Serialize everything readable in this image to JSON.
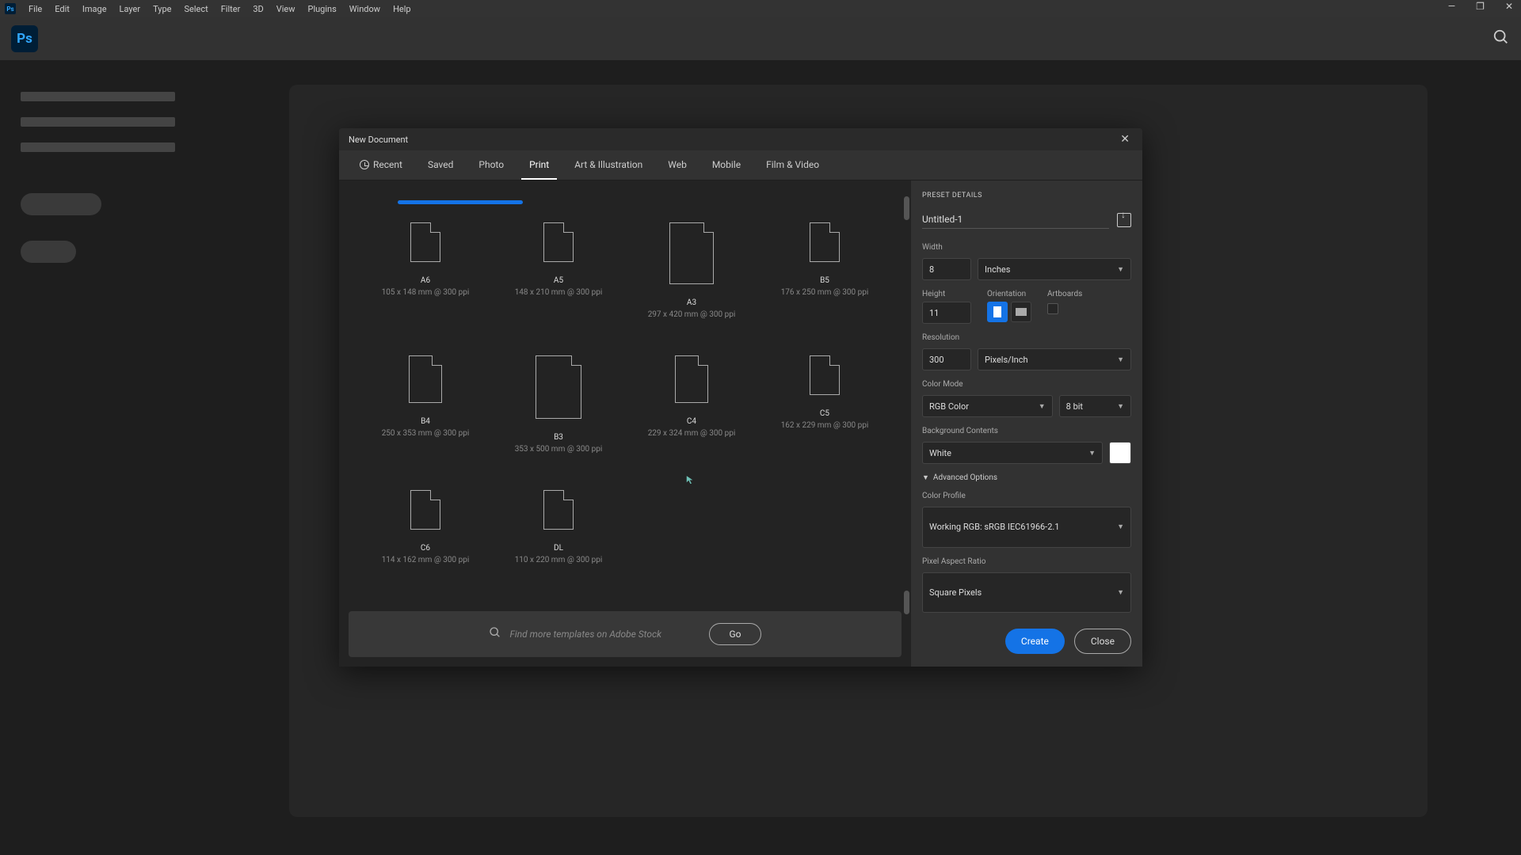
{
  "menu": {
    "items": [
      "File",
      "Edit",
      "Image",
      "Layer",
      "Type",
      "Select",
      "Filter",
      "3D",
      "View",
      "Plugins",
      "Window",
      "Help"
    ]
  },
  "app": {
    "short": "Ps"
  },
  "dialog": {
    "title": "New Document",
    "tabs": [
      "Recent",
      "Saved",
      "Photo",
      "Print",
      "Art & Illustration",
      "Web",
      "Mobile",
      "Film & Video"
    ],
    "active_tab": "Print",
    "presets": [
      {
        "name": "A6",
        "meta": "105 x 148 mm @ 300 ppi",
        "icon": "doc-icon"
      },
      {
        "name": "A5",
        "meta": "148 x 210 mm @ 300 ppi",
        "icon": "doc-icon"
      },
      {
        "name": "A3",
        "meta": "297 x 420 mm @ 300 ppi",
        "icon": "doc-icon wide"
      },
      {
        "name": "B5",
        "meta": "176 x 250 mm @ 300 ppi",
        "icon": "doc-icon"
      },
      {
        "name": "B4",
        "meta": "250 x 353 mm @ 300 ppi",
        "icon": "doc-icon tall"
      },
      {
        "name": "B3",
        "meta": "353 x 500 mm @ 300 ppi",
        "icon": "doc-icon xl"
      },
      {
        "name": "C4",
        "meta": "229 x 324 mm @ 300 ppi",
        "icon": "doc-icon tall"
      },
      {
        "name": "C5",
        "meta": "162 x 229 mm @ 300 ppi",
        "icon": "doc-icon"
      },
      {
        "name": "C6",
        "meta": "114 x 162 mm @ 300 ppi",
        "icon": "doc-icon"
      },
      {
        "name": "DL",
        "meta": "110 x 220 mm @ 300 ppi",
        "icon": "doc-icon"
      }
    ],
    "search": {
      "placeholder": "Find more templates on Adobe Stock",
      "go": "Go"
    },
    "details": {
      "header": "PRESET DETAILS",
      "name": "Untitled-1",
      "width_label": "Width",
      "width": "8",
      "width_unit": "Inches",
      "height_label": "Height",
      "height": "11",
      "orientation_label": "Orientation",
      "artboards_label": "Artboards",
      "resolution_label": "Resolution",
      "resolution": "300",
      "resolution_unit": "Pixels/Inch",
      "color_mode_label": "Color Mode",
      "color_mode": "RGB Color",
      "bit_depth": "8 bit",
      "bg_label": "Background Contents",
      "bg": "White",
      "adv": "Advanced Options",
      "profile_label": "Color Profile",
      "profile": "Working RGB: sRGB IEC61966-2.1",
      "pixel_label": "Pixel Aspect Ratio",
      "pixel": "Square Pixels",
      "create": "Create",
      "close": "Close"
    }
  }
}
